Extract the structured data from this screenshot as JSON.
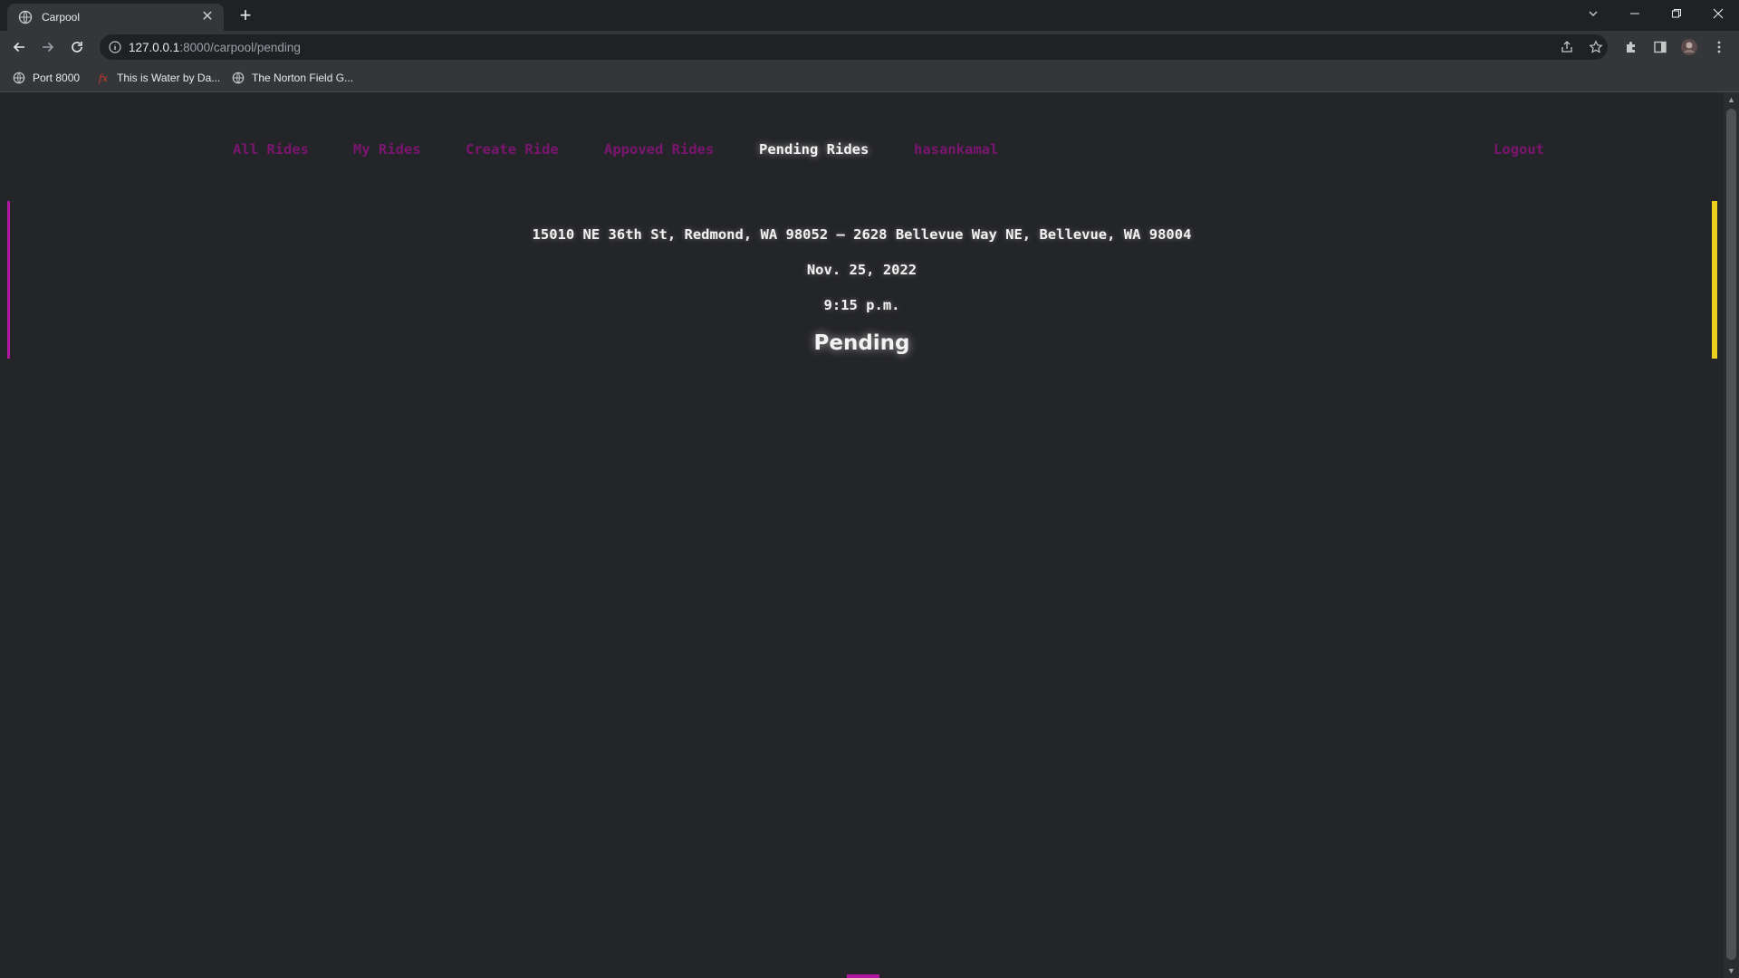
{
  "browser": {
    "tab_title": "Carpool",
    "url_host": "127.0.0.1",
    "url_path": ":8000/carpool/pending",
    "bookmarks": [
      {
        "label": "Port 8000"
      },
      {
        "label": "This is Water by Da..."
      },
      {
        "label": "The Norton Field G..."
      }
    ]
  },
  "nav": {
    "items": [
      {
        "label": "All Rides"
      },
      {
        "label": "My Rides"
      },
      {
        "label": "Create Ride"
      },
      {
        "label": "Appoved Rides"
      },
      {
        "label": "Pending Rides"
      },
      {
        "label": "hasankamal"
      }
    ],
    "logout": "Logout",
    "active": "Pending Rides"
  },
  "ride": {
    "route": "15010 NE 36th St, Redmond, WA 98052 – 2628 Bellevue Way NE, Bellevue, WA 98004",
    "date": "Nov. 25, 2022",
    "time": "9:15 p.m.",
    "status": "Pending"
  },
  "colors": {
    "background": "#242528",
    "nav_link": "#7a1570",
    "accent_left": "#b0179e",
    "accent_right": "#ecd01e"
  }
}
